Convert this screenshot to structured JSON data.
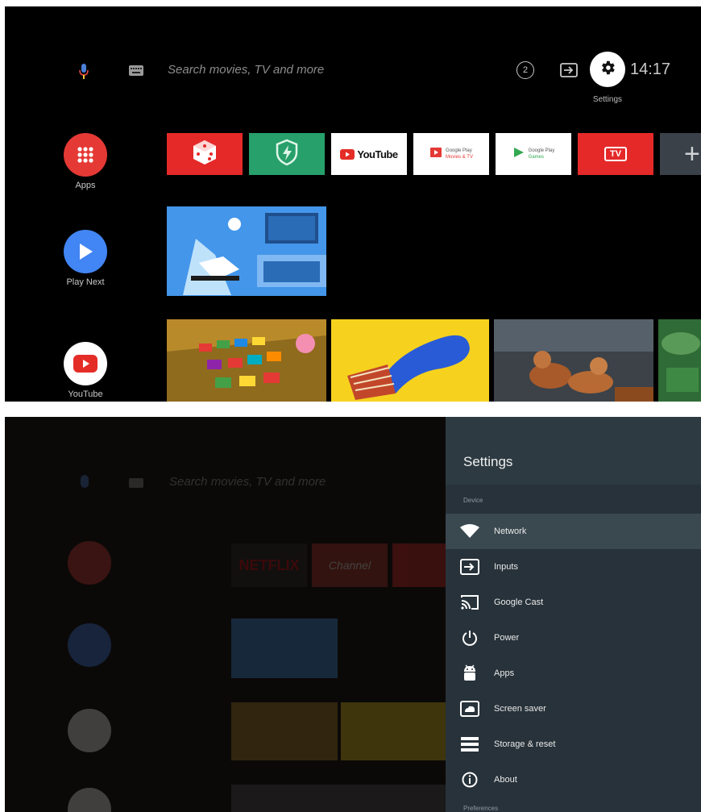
{
  "top_screen": {
    "search": {
      "placeholder": "Search movies, TV and more"
    },
    "time": "14:17",
    "settings_label": "Settings",
    "notifications_count": "2",
    "rail": [
      {
        "label": "Apps",
        "color": "#e53935"
      },
      {
        "label": "Play Next",
        "color": "#4285f4"
      },
      {
        "label": "YouTube",
        "color": "#ffffff"
      }
    ],
    "apps": [
      {
        "name": "game-app",
        "color": "#e52929"
      },
      {
        "name": "shield-app",
        "color": "#27a06b"
      },
      {
        "name": "YouTube",
        "text": "YouTube",
        "color": "#ffffff"
      },
      {
        "name": "Google Play Movies & TV",
        "line1": "Google Play",
        "line2": "Movies & TV",
        "color": "#ffffff"
      },
      {
        "name": "Google Play Games",
        "line1": "Google Play",
        "line2": "Games",
        "color": "#ffffff"
      },
      {
        "name": "TV",
        "text": "TV",
        "color": "#e52929"
      },
      {
        "name": "add-app",
        "text": "+",
        "color": "#3a4148"
      }
    ]
  },
  "bottom_screen": {
    "search": {
      "placeholder": "Search movies, TV and more"
    },
    "apps": [
      {
        "name": "Netflix",
        "text": "NETFLIX"
      },
      {
        "name": "T Channel",
        "text": "Channel"
      }
    ],
    "settings": {
      "title": "Settings",
      "section_device": "Device",
      "section_preferences": "Preferences",
      "items": [
        {
          "label": "Network",
          "icon": "wifi-icon",
          "selected": true
        },
        {
          "label": "Inputs",
          "icon": "input-icon"
        },
        {
          "label": "Google Cast",
          "icon": "cast-icon"
        },
        {
          "label": "Power",
          "icon": "power-icon"
        },
        {
          "label": "Apps",
          "icon": "android-icon"
        },
        {
          "label": "Screen saver",
          "icon": "screensaver-icon"
        },
        {
          "label": "Storage & reset",
          "icon": "storage-icon"
        },
        {
          "label": "About",
          "icon": "info-icon"
        }
      ]
    }
  }
}
